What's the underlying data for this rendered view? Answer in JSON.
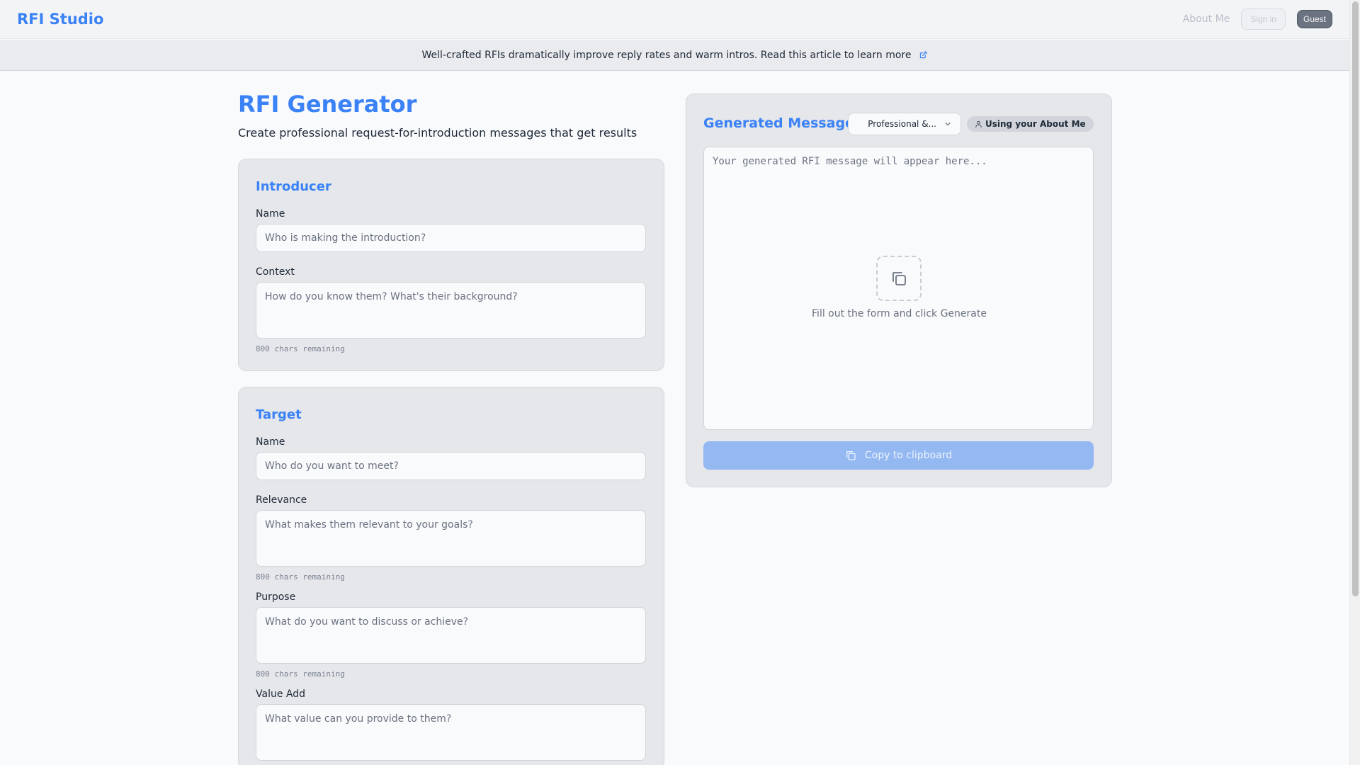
{
  "nav": {
    "brand": "RFI Studio",
    "about_me": "About Me",
    "sign_in": "Sign in",
    "guest": "Guest"
  },
  "banner": {
    "text": "Well-crafted RFIs dramatically improve reply rates and warm intros. Read this article to learn more",
    "icon": "external-link-icon"
  },
  "page": {
    "title": "RFI Generator",
    "subtitle": "Create professional request-for-introduction messages that get results"
  },
  "introducer": {
    "heading": "Introducer",
    "name_label": "Name",
    "name_placeholder": "Who is making the introduction?",
    "context_label": "Context",
    "context_placeholder": "How do you know them? What's their background?",
    "context_remaining": "800 chars remaining"
  },
  "target": {
    "heading": "Target",
    "name_label": "Name",
    "name_placeholder": "Who do you want to meet?",
    "relevance_label": "Relevance",
    "relevance_placeholder": "What makes them relevant to your goals?",
    "relevance_remaining": "800 chars remaining",
    "purpose_label": "Purpose",
    "purpose_placeholder": "What do you want to discuss or achieve?",
    "purpose_remaining": "800 chars remaining",
    "value_add_label": "Value Add",
    "value_add_placeholder": "What value can you provide to them?"
  },
  "generated": {
    "title": "Generated Message",
    "tone_selected": "Professional &...",
    "about_badge": "Using your About Me",
    "output_placeholder": "Your generated RFI message will appear here...",
    "empty_text": "Fill out the form and click Generate",
    "copy_label": "Copy to clipboard"
  },
  "colors": {
    "accent": "#3b82f6",
    "panel": "#e5e7eb",
    "copy_button_disabled": "#93b8f2"
  }
}
